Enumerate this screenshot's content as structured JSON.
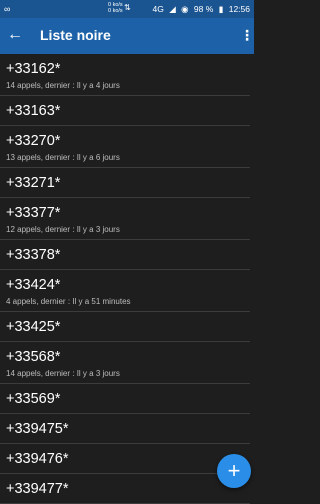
{
  "status_bar": {
    "left_icon": "link-icon",
    "net_speed_top": "0 ko/s",
    "net_speed_bottom": "0 ko/s",
    "signal": "4G",
    "battery": "98 %",
    "time": "12:56"
  },
  "app_bar": {
    "title": "Liste noire"
  },
  "entries": [
    {
      "number": "+33162*",
      "detail": "14 appels, dernier : Il y a 4 jours"
    },
    {
      "number": "+33163*",
      "detail": ""
    },
    {
      "number": "+33270*",
      "detail": "13 appels, dernier : Il y a 6 jours"
    },
    {
      "number": "+33271*",
      "detail": ""
    },
    {
      "number": "+33377*",
      "detail": "12 appels, dernier : Il y a 3 jours"
    },
    {
      "number": "+33378*",
      "detail": ""
    },
    {
      "number": "+33424*",
      "detail": "4 appels, dernier : Il y a 51 minutes"
    },
    {
      "number": "+33425*",
      "detail": ""
    },
    {
      "number": "+33568*",
      "detail": "14 appels, dernier : Il y a 3 jours"
    },
    {
      "number": "+33569*",
      "detail": ""
    },
    {
      "number": "+339475*",
      "detail": ""
    },
    {
      "number": "+339476*",
      "detail": ""
    },
    {
      "number": "+339477*",
      "detail": ""
    }
  ],
  "fab": {
    "icon": "plus-icon",
    "label": "+"
  },
  "colors": {
    "status_bar": "#1b5591",
    "app_bar": "#1d62a8",
    "background": "#1e1e1e",
    "fab": "#2a8ee8"
  }
}
